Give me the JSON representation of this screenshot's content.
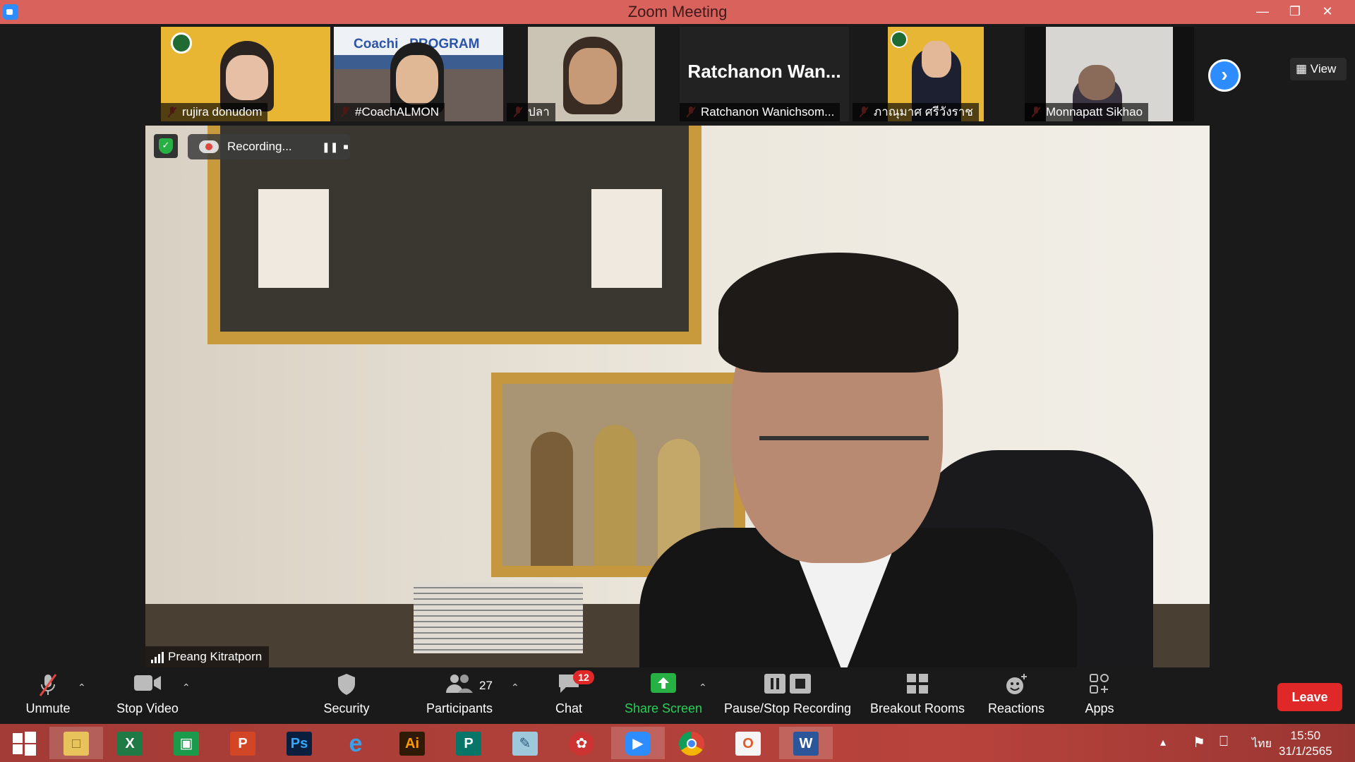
{
  "window": {
    "title": "Zoom Meeting"
  },
  "thumbnails": [
    {
      "name": "rujira donudom",
      "bg": "#e8b632"
    },
    {
      "name": "#CoachALMON",
      "bg": "#3b5d8f",
      "overlay": "Coachi   PROGRAM"
    },
    {
      "name": "ปลา",
      "bg": "#c9c0b0"
    },
    {
      "name": "Ratchanon Wanichsom...",
      "bg": "#222222",
      "display": "Ratchanon  Wan..."
    },
    {
      "name": "ภาณุมาศ ศรีวังราช",
      "bg": "#e6b634"
    },
    {
      "name": "Monnapatt Sikhao",
      "bg": "#d8d6d2"
    }
  ],
  "view_label": "View",
  "recording": {
    "label": "Recording..."
  },
  "speaker": {
    "name": "Preang Kitratporn"
  },
  "toolbar": {
    "unmute": "Unmute",
    "stop_video": "Stop Video",
    "security": "Security",
    "participants": "Participants",
    "participants_count": "27",
    "chat": "Chat",
    "chat_badge": "12",
    "share_screen": "Share Screen",
    "pause_stop_recording": "Pause/Stop Recording",
    "breakout_rooms": "Breakout Rooms",
    "reactions": "Reactions",
    "apps": "Apps",
    "leave": "Leave"
  },
  "taskbar": {
    "apps": [
      "windows",
      "file-explorer",
      "excel",
      "store",
      "powerpoint",
      "photoshop",
      "internet-explorer",
      "illustrator",
      "publisher",
      "notepad",
      "photoscape",
      "zoom",
      "chrome",
      "office",
      "word"
    ],
    "language": "ไทย",
    "time": "15:50",
    "date": "31/1/2565"
  },
  "colors": {
    "titlebar": "#d9625c",
    "accent": "#2d8cff",
    "leave": "#e02828",
    "share": "#27b043"
  }
}
